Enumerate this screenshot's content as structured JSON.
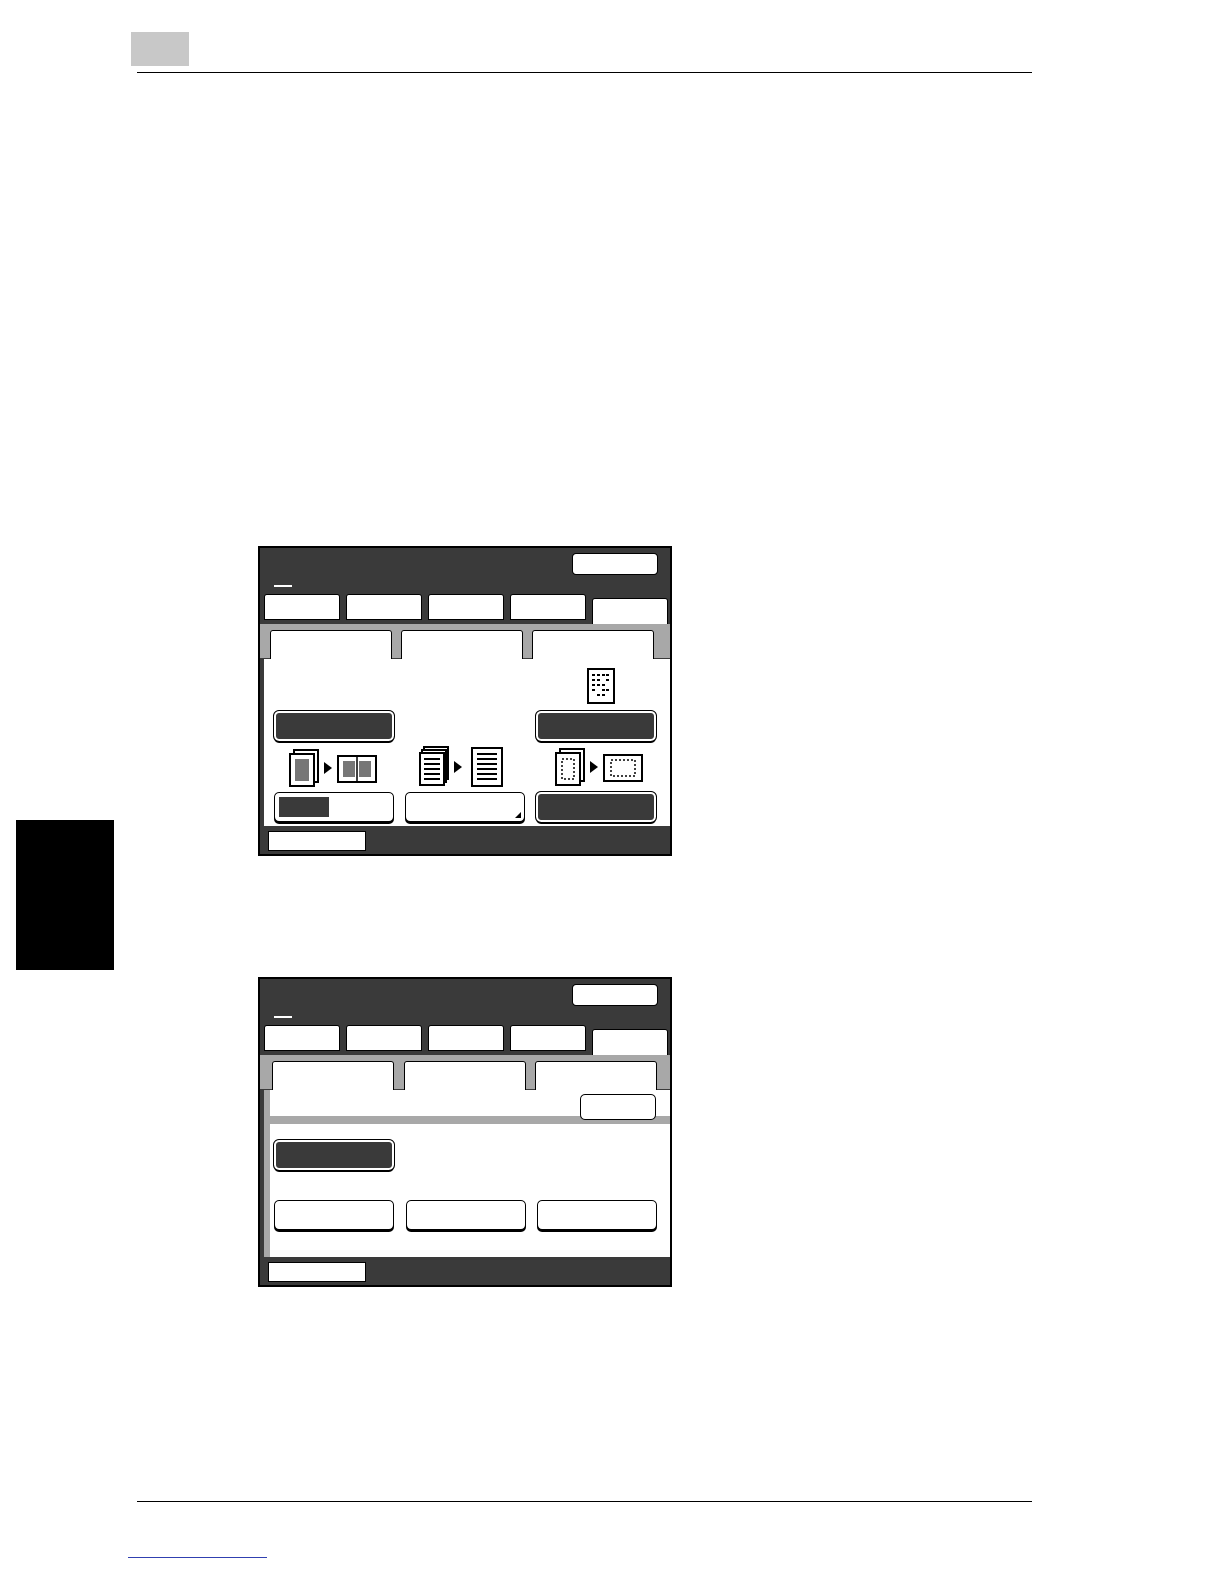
{
  "page": {
    "header_chapter": "",
    "footer_text": ""
  },
  "panels": [
    {
      "id": "panel-1",
      "mode_tabs": [
        "",
        "",
        "",
        "",
        ""
      ],
      "sub_tabs": [
        "",
        "",
        ""
      ],
      "icons": [
        "single-page-text-icon",
        "book-to-spread-icon",
        "multi-page-to-single-icon",
        "page-to-frame-icon"
      ]
    },
    {
      "id": "panel-2",
      "mode_tabs": [
        "",
        "",
        "",
        "",
        ""
      ],
      "sub_tabs": [
        "",
        "",
        ""
      ]
    }
  ],
  "colors": {
    "panel_dark": "#3a3a3a",
    "strip_gray": "#a8a8a8",
    "header_tab_gray": "#c8c8c8",
    "side_tab": "#000000",
    "footer_link": "#3040b0"
  }
}
